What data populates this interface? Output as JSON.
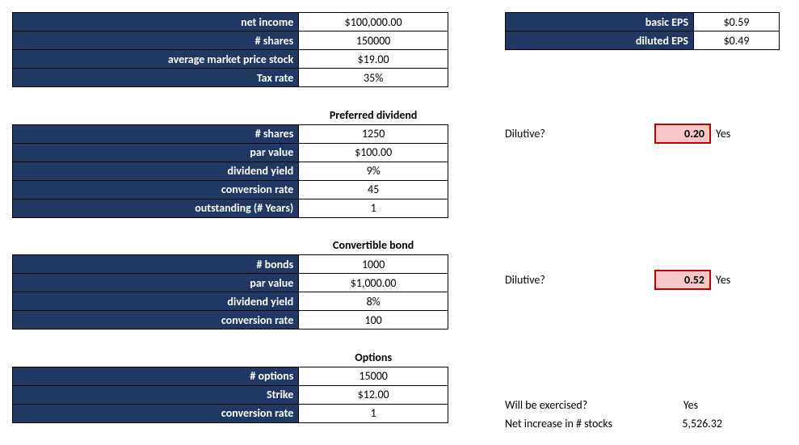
{
  "chart_data": {
    "type": "table",
    "inputs": {
      "net_income": 100000,
      "shares": 150000,
      "avg_market_price": 19.0,
      "tax_rate": 0.35
    },
    "preferred_dividend": {
      "shares": 1250,
      "par_value": 100.0,
      "dividend_yield": 0.09,
      "conversion_rate": 45,
      "outstanding_years": 1
    },
    "convertible_bond": {
      "bonds": 1000,
      "par_value": 1000.0,
      "dividend_yield": 0.08,
      "conversion_rate": 100
    },
    "options": {
      "options": 15000,
      "strike": 12.0,
      "conversion_rate": 1
    },
    "results": {
      "basic_eps": 0.59,
      "diluted_eps": 0.49,
      "preferred_dilutive_value": 0.2,
      "preferred_dilutive": "Yes",
      "bond_dilutive_value": 0.52,
      "bond_dilutive": "Yes",
      "options_exercised": "Yes",
      "net_increase_stocks": 5526.32
    }
  },
  "top": {
    "net_income": {
      "label": "net income",
      "value": "$100,000.00"
    },
    "shares": {
      "label": "# shares",
      "value": "150000"
    },
    "avg_price": {
      "label": "average market price stock",
      "value": "$19.00"
    },
    "tax_rate": {
      "label": "Tax rate",
      "value": "35%"
    }
  },
  "eps": {
    "basic": {
      "label": "basic EPS",
      "value": "$0.59"
    },
    "diluted": {
      "label": "diluted EPS",
      "value": "$0.49"
    }
  },
  "pref": {
    "title": "Preferred dividend",
    "shares": {
      "label": "# shares",
      "value": "1250"
    },
    "par": {
      "label": "par value",
      "value": "$100.00"
    },
    "yield": {
      "label": "dividend yield",
      "value": "9%"
    },
    "conv": {
      "label": "conversion rate",
      "value": "45"
    },
    "out": {
      "label": "outstanding (# Years)",
      "value": "1"
    },
    "dilutive_q": "Dilutive?",
    "dilutive_val": "0.20",
    "dilutive_ans": "Yes"
  },
  "bond": {
    "title": "Convertible bond",
    "bonds": {
      "label": "# bonds",
      "value": "1000"
    },
    "par": {
      "label": "par value",
      "value": "$1,000.00"
    },
    "yield": {
      "label": "dividend yield",
      "value": "8%"
    },
    "conv": {
      "label": "conversion rate",
      "value": "100"
    },
    "dilutive_q": "Dilutive?",
    "dilutive_val": "0.52",
    "dilutive_ans": "Yes"
  },
  "opt": {
    "title": "Options",
    "opts": {
      "label": "# options",
      "value": "15000"
    },
    "strike": {
      "label": "Strike",
      "value": "$12.00"
    },
    "conv": {
      "label": "conversion rate",
      "value": "1"
    },
    "exercised_q": "Will be exercised?",
    "exercised_ans": "Yes",
    "netinc_q": "Net increase in # stocks",
    "netinc_val": "5,526.32"
  }
}
